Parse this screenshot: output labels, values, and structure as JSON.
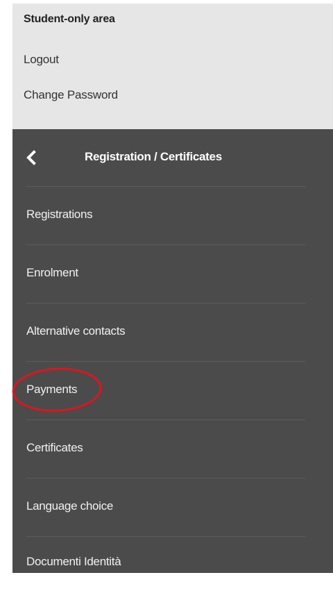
{
  "top_panel": {
    "title": "Student-only area",
    "logout_label": "Logout",
    "change_password_label": "Change Password"
  },
  "menu": {
    "header_title": "Registration / Certificates",
    "back_icon": "chevron-left-icon",
    "items": [
      {
        "label": "Registrations"
      },
      {
        "label": "Enrolment"
      },
      {
        "label": "Alternative contacts"
      },
      {
        "label": "Payments",
        "highlighted": true
      },
      {
        "label": "Certificates"
      },
      {
        "label": "Language choice"
      },
      {
        "label": "Documenti Identità"
      }
    ]
  },
  "annotation": {
    "type": "circle",
    "color": "#e0141e",
    "target": "Payments"
  },
  "colors": {
    "top_panel_bg": "#e6e6e6",
    "menu_bg": "#4b4b4b",
    "menu_text": "#f1f1f1",
    "divider": "#5d5d5d"
  }
}
